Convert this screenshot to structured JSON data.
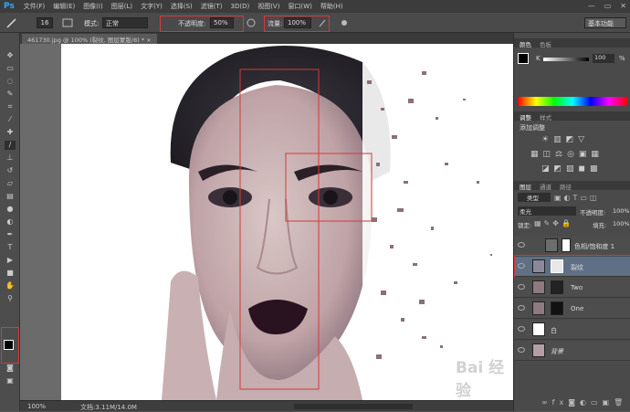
{
  "app": {
    "logo": "Ps",
    "window_buttons": [
      "—",
      "▭",
      "✕"
    ]
  },
  "menu": [
    "文件(F)",
    "编辑(E)",
    "图像(I)",
    "图层(L)",
    "文字(Y)",
    "选择(S)",
    "滤镜(T)",
    "3D(D)",
    "视图(V)",
    "窗口(W)",
    "帮助(H)"
  ],
  "options": {
    "brush_size": "16",
    "mode_label": "模式:",
    "mode_value": "正常",
    "opacity_label": "不透明度:",
    "opacity_value": "50%",
    "flow_label": "流量:",
    "flow_value": "100%",
    "workspace": "基本功能"
  },
  "document": {
    "tab_title": "461730.jpg @ 100% (裂纹, 图层蒙版/8) *",
    "tab_close": "×",
    "zoom": "100%",
    "doc_info": "文档:3.11M/14.0M"
  },
  "color_panel": {
    "tabs": [
      "颜色",
      "色板"
    ],
    "channel": "K",
    "value": "100",
    "unit": "%"
  },
  "adjust_panel": {
    "tabs": [
      "调整",
      "样式"
    ],
    "title": "添加调整"
  },
  "layers_panel": {
    "tabs": [
      "图层",
      "通道",
      "路径"
    ],
    "kind": "类型",
    "blend": "柔光",
    "opacity_label": "不透明度:",
    "opacity_value": "100%",
    "lock_label": "锁定:",
    "fill_label": "填充:",
    "fill_value": "100%",
    "layers": [
      {
        "name": "色相/饱和度 1"
      },
      {
        "name": "裂纹"
      },
      {
        "name": "Two"
      },
      {
        "name": "One"
      },
      {
        "name": "白"
      },
      {
        "name": "背景"
      }
    ]
  },
  "watermark": "Bai 经验",
  "colors": {
    "accent": "#31a8ff",
    "highlight_box": "#d43a3a"
  }
}
